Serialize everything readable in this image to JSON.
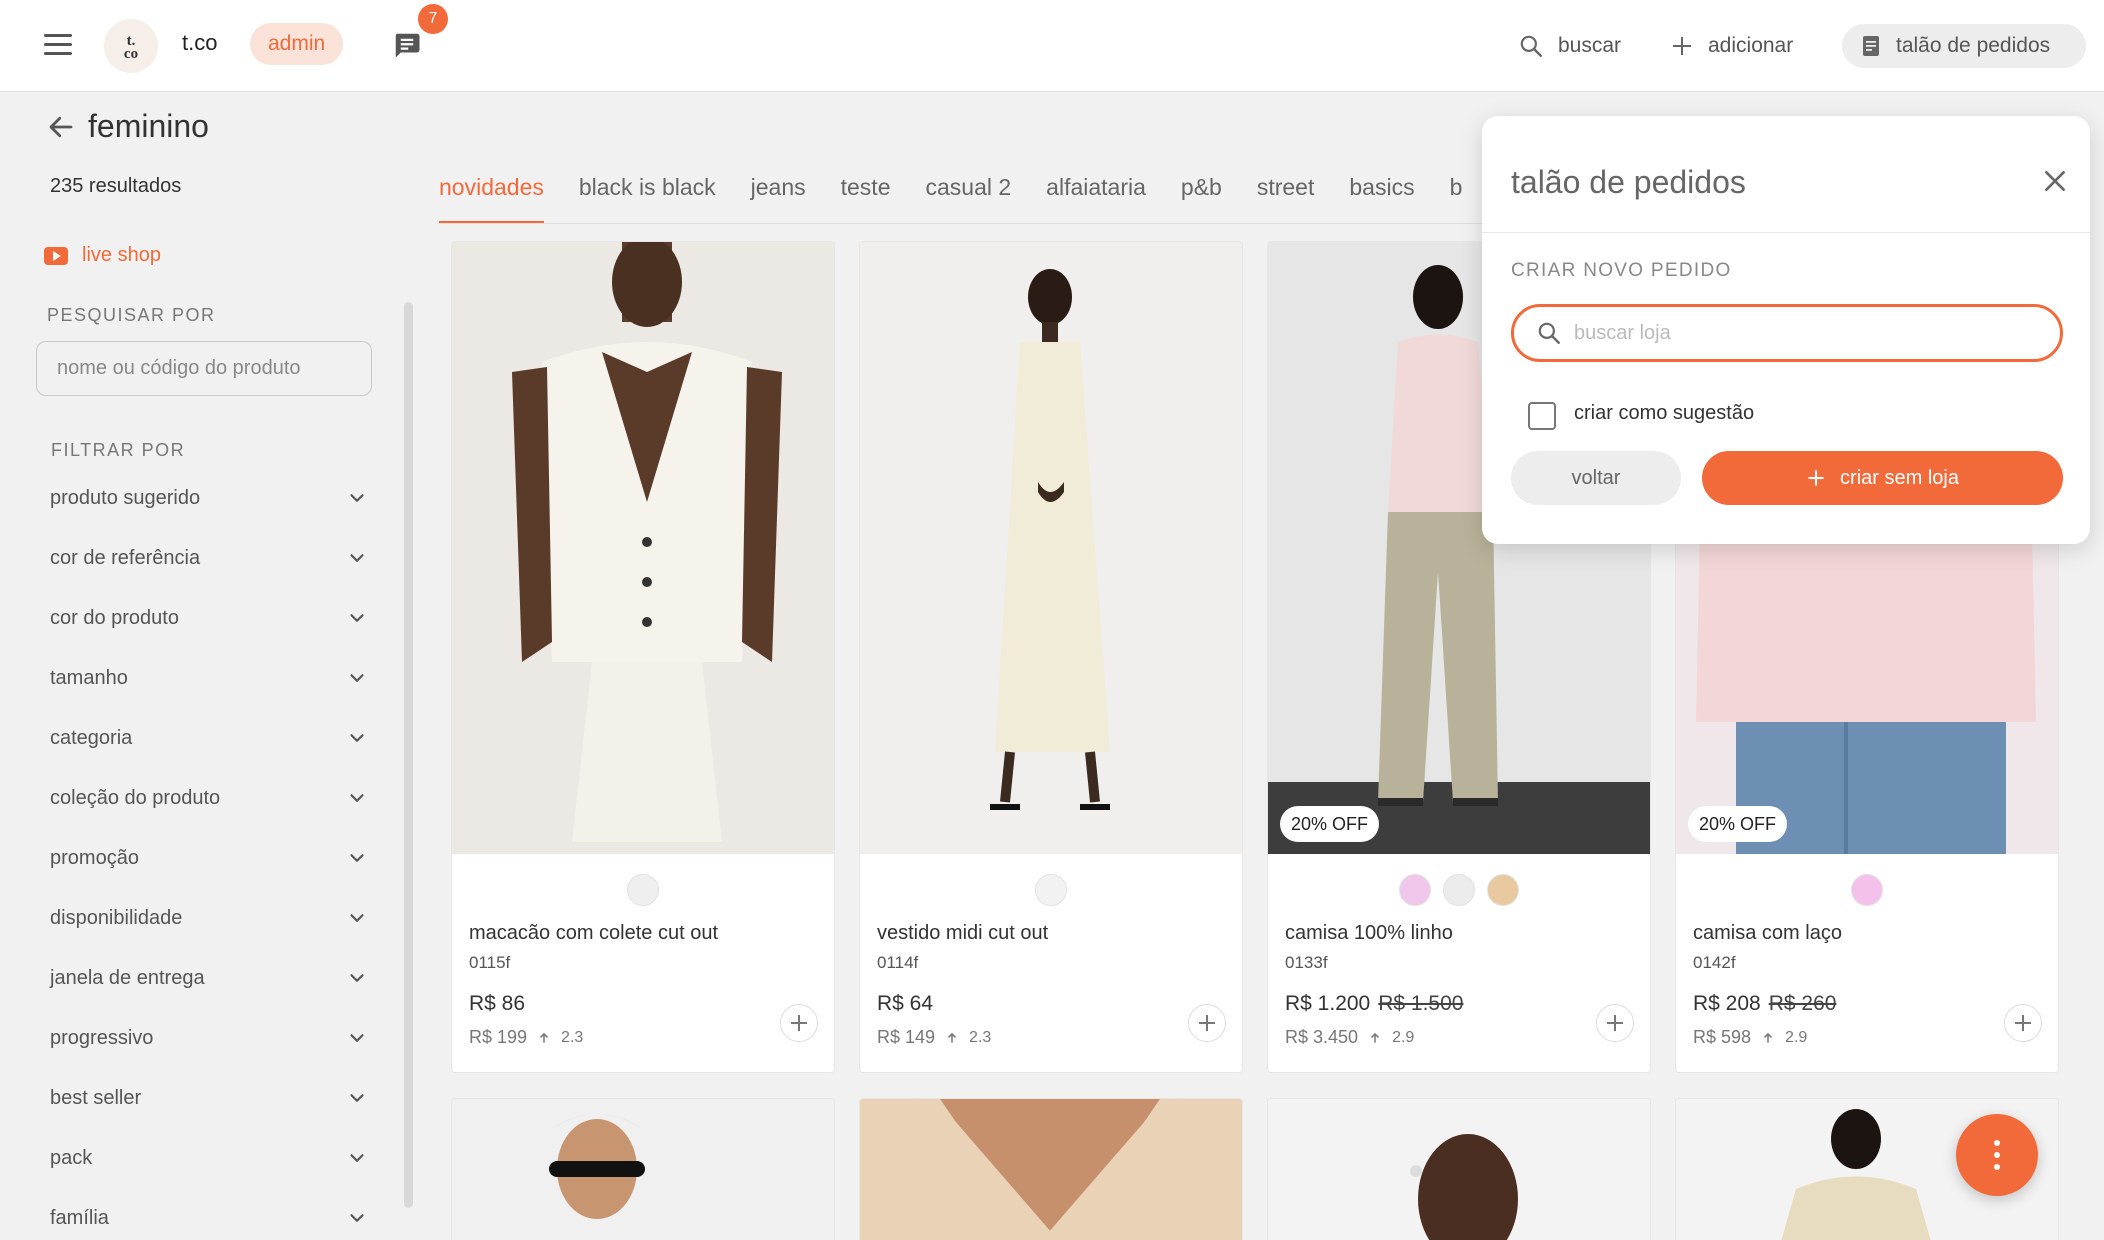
{
  "topbar": {
    "logo_text": "t.\nco",
    "brand": "t.co",
    "role_badge": "admin",
    "chat_count": "7",
    "search_label": "buscar",
    "add_label": "adicionar",
    "orders_label": "talão de pedidos"
  },
  "page": {
    "title": "feminino",
    "results": "235 resultados",
    "live_shop": "live shop"
  },
  "sidebar": {
    "search_label": "PESQUISAR POR",
    "search_placeholder": "nome ou código do produto",
    "filter_label": "FILTRAR POR",
    "filters": [
      "produto sugerido",
      "cor de referência",
      "cor do produto",
      "tamanho",
      "categoria",
      "coleção do produto",
      "promoção",
      "disponibilidade",
      "janela de entrega",
      "progressivo",
      "best seller",
      "pack",
      "família"
    ]
  },
  "tabs": [
    "novidades",
    "black is black",
    "jeans",
    "teste",
    "casual 2",
    "alfaiataria",
    "p&b",
    "street",
    "basics",
    "b"
  ],
  "products": [
    {
      "name": "macacão com colete cut out",
      "code": "0115f",
      "price": "R$ 86",
      "old_price": "",
      "retail": "R$ 199",
      "markup": "2.3",
      "badge": "",
      "swatches": [
        "#efefef"
      ],
      "bg": "#eae8e4"
    },
    {
      "name": "vestido midi cut out",
      "code": "0114f",
      "price": "R$ 64",
      "old_price": "",
      "retail": "R$ 149",
      "markup": "2.3",
      "badge": "",
      "swatches": [
        "#f2f2f2"
      ],
      "bg": "#efefed"
    },
    {
      "name": "camisa 100% linho",
      "code": "0133f",
      "price": "R$ 1.200",
      "old_price": "R$ 1.500",
      "retail": "R$ 3.450",
      "markup": "2.9",
      "badge": "20% OFF",
      "swatches": [
        "#f0c6ea",
        "#ececec",
        "#e8c9a0"
      ],
      "bg": "#e6e6e6"
    },
    {
      "name": "camisa com laço",
      "code": "0142f",
      "price": "R$ 208",
      "old_price": "R$ 260",
      "retail": "R$ 598",
      "markup": "2.9",
      "badge": "20% OFF",
      "swatches": [
        "#f4c0ec"
      ],
      "bg": "#efe7e9"
    }
  ],
  "popover": {
    "title": "talão de pedidos",
    "section": "CRIAR NOVO PEDIDO",
    "search_placeholder": "buscar loja",
    "checkbox_label": "criar como sugestão",
    "back_label": "voltar",
    "create_label": "criar sem loja"
  },
  "colors": {
    "accent": "#f26a3a",
    "accent_soft": "#fbe3d9",
    "background": "#f1f1f1"
  }
}
